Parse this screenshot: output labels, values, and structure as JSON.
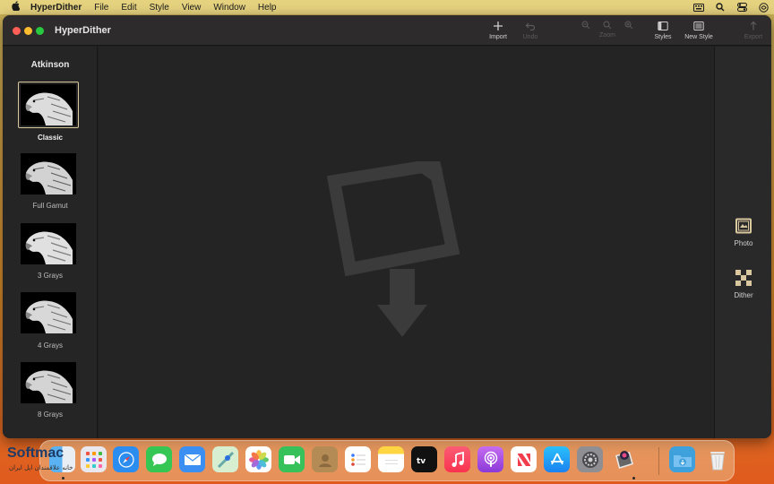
{
  "menubar": {
    "app_name": "HyperDither",
    "menus": [
      "File",
      "Edit",
      "Style",
      "View",
      "Window",
      "Help"
    ]
  },
  "window": {
    "title": "HyperDither",
    "toolbar": {
      "import": "Import",
      "undo": "Undo",
      "zoom": "Zoom",
      "styles": "Styles",
      "new_style": "New Style",
      "export": "Export"
    }
  },
  "sidebar": {
    "title": "Atkinson",
    "items": [
      {
        "label": "Classic",
        "selected": true
      },
      {
        "label": "Full Gamut",
        "selected": false
      },
      {
        "label": "3 Grays",
        "selected": false
      },
      {
        "label": "4 Grays",
        "selected": false
      },
      {
        "label": "8 Grays",
        "selected": false
      }
    ]
  },
  "right_panel": {
    "photo_label": "Photo",
    "dither_label": "Dither"
  },
  "dock": {
    "apps": [
      "finder",
      "launchpad",
      "safari",
      "messages",
      "mail",
      "maps",
      "photos",
      "facetime",
      "contacts",
      "reminders",
      "notes",
      "apple-tv",
      "music",
      "podcasts",
      "news",
      "app-store",
      "system-preferences",
      "hyperdither",
      "downloads",
      "trash"
    ]
  },
  "watermark": {
    "logo": "Softmac",
    "subtitle": "خانه علاقمندان اپل ایران"
  },
  "colors": {
    "accent_selected": "#d9c7a0",
    "window_bg": "#1f1f1f"
  }
}
